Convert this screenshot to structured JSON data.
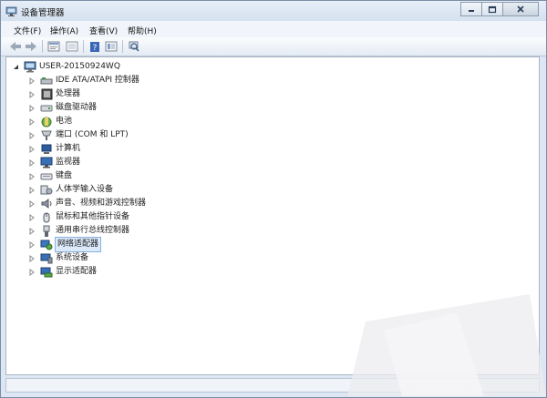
{
  "window": {
    "title": "设备管理器"
  },
  "menu": [
    "文件(F)",
    "操作(A)",
    "查看(V)",
    "帮助(H)"
  ],
  "toolbar": {
    "buttons": [
      "back-icon",
      "forward-icon",
      "properties-icon",
      "update-icon",
      "help-icon",
      "view-icon",
      "scan-hardware-icon"
    ]
  },
  "tree": {
    "root": "USER-20150924WQ",
    "categories": [
      {
        "label": "IDE ATA/ATAPI 控制器",
        "icon": "ide-controller-icon"
      },
      {
        "label": "处理器",
        "icon": "processor-icon"
      },
      {
        "label": "磁盘驱动器",
        "icon": "disk-drive-icon"
      },
      {
        "label": "电池",
        "icon": "battery-icon"
      },
      {
        "label": "端口 (COM 和 LPT)",
        "icon": "port-icon"
      },
      {
        "label": "计算机",
        "icon": "computer-icon"
      },
      {
        "label": "监视器",
        "icon": "monitor-icon"
      },
      {
        "label": "键盘",
        "icon": "keyboard-icon"
      },
      {
        "label": "人体学输入设备",
        "icon": "hid-icon"
      },
      {
        "label": "声音、视频和游戏控制器",
        "icon": "sound-icon"
      },
      {
        "label": "鼠标和其他指针设备",
        "icon": "mouse-icon"
      },
      {
        "label": "通用串行总线控制器",
        "icon": "usb-icon"
      },
      {
        "label": "网络适配器",
        "icon": "network-adapter-icon",
        "selected": true
      },
      {
        "label": "系统设备",
        "icon": "system-device-icon"
      },
      {
        "label": "显示适配器",
        "icon": "display-adapter-icon"
      }
    ]
  }
}
